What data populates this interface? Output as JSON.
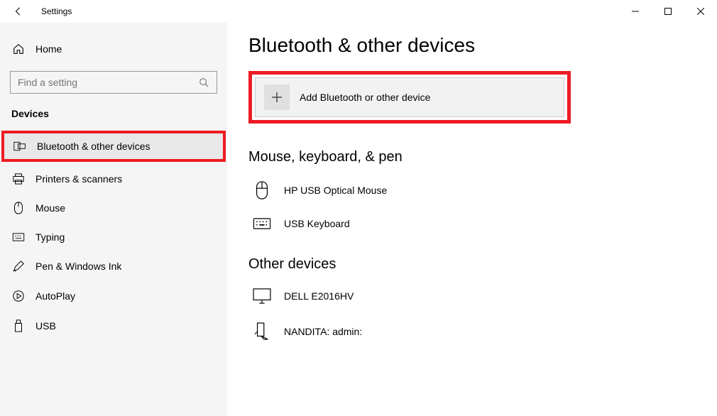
{
  "window": {
    "title": "Settings"
  },
  "sidebar": {
    "home_label": "Home",
    "search_placeholder": "Find a setting",
    "category_label": "Devices",
    "items": [
      {
        "label": "Bluetooth & other devices",
        "icon": "bluetooth-devices-icon",
        "selected": true
      },
      {
        "label": "Printers & scanners",
        "icon": "printer-icon"
      },
      {
        "label": "Mouse",
        "icon": "mouse-icon"
      },
      {
        "label": "Typing",
        "icon": "keyboard-icon"
      },
      {
        "label": "Pen & Windows Ink",
        "icon": "pen-icon"
      },
      {
        "label": "AutoPlay",
        "icon": "autoplay-icon"
      },
      {
        "label": "USB",
        "icon": "usb-icon"
      }
    ]
  },
  "main": {
    "title": "Bluetooth & other devices",
    "add_label": "Add Bluetooth or other device",
    "sections": [
      {
        "title": "Mouse, keyboard, & pen",
        "devices": [
          {
            "name": "HP USB Optical Mouse",
            "icon": "mouse-device-icon"
          },
          {
            "name": "USB Keyboard",
            "icon": "keyboard-device-icon"
          }
        ]
      },
      {
        "title": "Other devices",
        "devices": [
          {
            "name": "DELL E2016HV",
            "icon": "monitor-icon"
          },
          {
            "name": "NANDITA: admin:",
            "icon": "miracast-icon"
          }
        ]
      }
    ]
  },
  "highlights": [
    "sidebar-item-bluetooth",
    "add-device-button"
  ]
}
